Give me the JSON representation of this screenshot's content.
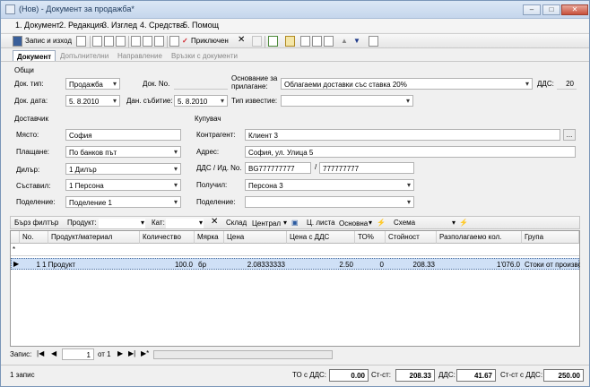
{
  "window": {
    "title": "(Нов) - Документ за продажба*"
  },
  "menu": [
    "1. Документ",
    "2. Редакция",
    "3. Изглед",
    "4. Средства",
    "5. Помощ"
  ],
  "toolbar": {
    "save_exit": "Запис и изход",
    "finish": "Приключен"
  },
  "tabs": [
    "Документ",
    "Допълнителни",
    "Направление",
    "Връзки с документи"
  ],
  "general": {
    "section": "Общи",
    "doc_type_label": "Док. тип:",
    "doc_type": "Продажба",
    "doc_no_label": "Док. No.",
    "doc_no": "",
    "basis_label": "Основание за прилагане:",
    "basis": "Облагаеми доставки със ставка 20%",
    "vat_label": "ДДС:",
    "vat": "20",
    "doc_date_label": "Док. дата:",
    "doc_date": "5. 8.2010",
    "tax_event_label": "Дан. събитие:",
    "tax_event": "5. 8.2010",
    "notice_label": "Тип известие:",
    "notice": ""
  },
  "supplier": {
    "section": "Доставчик",
    "place_label": "Място:",
    "place": "София",
    "payment_label": "Плащане:",
    "payment": "По банков път",
    "dealer_label": "Дилър:",
    "dealer": "1 Дилър",
    "author_label": "Съставил:",
    "author": "1 Персона",
    "division_label": "Поделение:",
    "division": "Поделение 1"
  },
  "buyer": {
    "section": "Купувач",
    "partner_label": "Контрагент:",
    "partner": "Клиент 3",
    "address_label": "Адрес:",
    "address": "София, ул. Улица 5",
    "vat_id_label": "ДДС / Ид. No.",
    "vat_no": "BG777777777",
    "id_no": "777777777",
    "recipient_label": "Получил:",
    "recipient": "Персона 3",
    "division_label": "Поделение:",
    "division": ""
  },
  "filter": {
    "quick_filter": "Бърз филтър",
    "product_label": "Продукт:",
    "cat_label": "Кат:",
    "warehouse_label": "Склад",
    "warehouse": "Централ",
    "price_list_label": "Ц. листа",
    "price_list": "Основна",
    "scheme_label": "Схема"
  },
  "grid": {
    "columns": [
      "No.",
      "Продукт/материал",
      "Количество",
      "Мярка",
      "Цена",
      "Цена с ДДС",
      "ТО%",
      "Стойност",
      "Разполагаемо кол.",
      "Група"
    ],
    "rows": [
      {
        "no": "1",
        "product": "1 Продукт",
        "qty": "100.0",
        "unit": "бр",
        "price": "2.08333333",
        "price_vat": "2.50",
        "discount": "0",
        "value": "208.33",
        "available": "1'076.0",
        "group": "Стоки от производ"
      }
    ]
  },
  "nav": {
    "record_label": "Запис:",
    "current": "1",
    "of": "от 1"
  },
  "status": {
    "count": "1 запис",
    "to_vat_label": "ТО с ДДС:",
    "to_vat": "0.00",
    "value_label": "Ст-ст:",
    "value": "208.33",
    "vat_label": "ДДС:",
    "vat": "41.67",
    "value_vat_label": "Ст-ст с ДДС:",
    "value_vat": "250.00"
  }
}
